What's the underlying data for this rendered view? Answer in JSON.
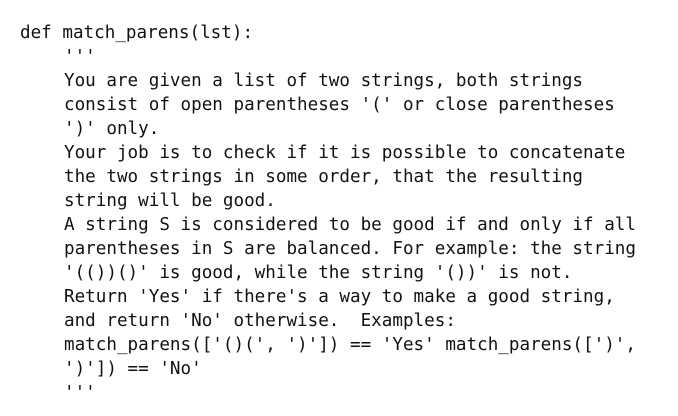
{
  "code": {
    "signature": "def match_parens(lst):",
    "docstring_open": "'''",
    "docstring_lines": [
      "You are given a list of two strings, both strings",
      "consist of open parentheses '(' or close parentheses",
      "')' only.",
      "Your job is to check if it is possible to concatenate",
      "the two strings in some order, that the resulting",
      "string will be good.",
      "A string S is considered to be good if and only if all",
      "parentheses in S are balanced. For example: the string",
      "'(())()' is good, while the string '())' is not.",
      "Return 'Yes' if there's a way to make a good string,",
      "and return 'No' otherwise.  Examples:",
      "match_parens(['()(', ')']) == 'Yes' match_parens([')',",
      "')']) == 'No'"
    ],
    "docstring_close": "'''"
  }
}
